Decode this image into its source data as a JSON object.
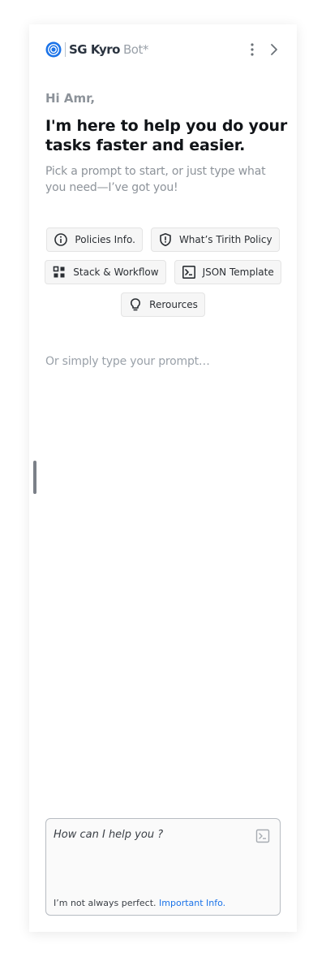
{
  "header": {
    "brand_name": "SG Kyro",
    "brand_suffix": "Bot*",
    "logo_icon": "target-logo-icon",
    "more_icon": "more-vertical-icon",
    "collapse_icon": "chevron-right-icon"
  },
  "welcome": {
    "greeting": "Hi Amr,",
    "headline": "I'm here to help you do your tasks faster and easier.",
    "subtext": "Pick a prompt to start, or just type what you need—I’ve got you!"
  },
  "prompts": [
    {
      "label": "Policies Info.",
      "icon": "info-icon"
    },
    {
      "label": "What’s Tirith Policy",
      "icon": "shield-alert-icon"
    },
    {
      "label": "Stack & Workflow",
      "icon": "grid-icon"
    },
    {
      "label": "JSON Template",
      "icon": "terminal-icon"
    },
    {
      "label": "Rerources",
      "icon": "lightbulb-icon"
    }
  ],
  "type_hint": "Or simply type your prompt…",
  "composer": {
    "placeholder": "How can I help you ?",
    "send_icon": "terminal-send-icon",
    "disclaimer_text": "I’m not always perfect.",
    "disclaimer_link": "Important Info."
  },
  "colors": {
    "brand_blue": "#1b73e8",
    "text_dark": "#111418",
    "text_muted": "#8d939a",
    "chip_bg": "#f6f6f6"
  }
}
